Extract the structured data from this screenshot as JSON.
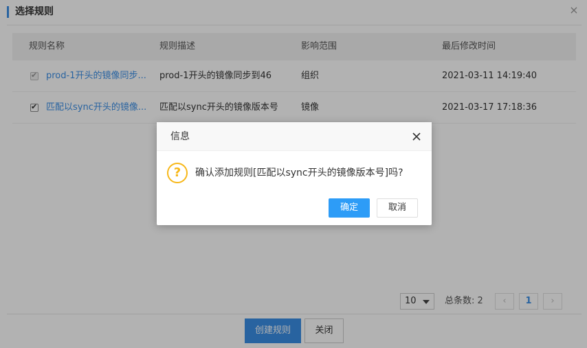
{
  "panel": {
    "title": "选择规则",
    "close_glyph": "×"
  },
  "table": {
    "columns": [
      "规则名称",
      "规则描述",
      "影响范围",
      "最后修改时间"
    ],
    "rows": [
      {
        "name": "prod-1开头的镜像同步...",
        "desc": "prod-1开头的镜像同步到46",
        "scope": "组织",
        "time": "2021-03-11 14:19:40",
        "checked": true,
        "disabled": true
      },
      {
        "name": "匹配以sync开头的镜像...",
        "desc": "匹配以sync开头的镜像版本号",
        "scope": "镜像",
        "time": "2021-03-17 17:18:36",
        "checked": true,
        "disabled": false
      }
    ]
  },
  "pager": {
    "page_size": "10",
    "total_label": "总条数: 2",
    "prev_glyph": "‹",
    "current_page": "1",
    "next_glyph": "›"
  },
  "footer": {
    "create_label": "创建规则",
    "close_label": "关闭"
  },
  "dialog": {
    "title": "信息",
    "icon_glyph": "?",
    "message": "确认添加规则[匹配以sync开头的镜像版本号]吗?",
    "ok_label": "确定",
    "cancel_label": "取消"
  },
  "colors": {
    "accent": "#3a8ee6",
    "ok_button": "#2d9cf7",
    "warning_icon": "#f7b718"
  }
}
